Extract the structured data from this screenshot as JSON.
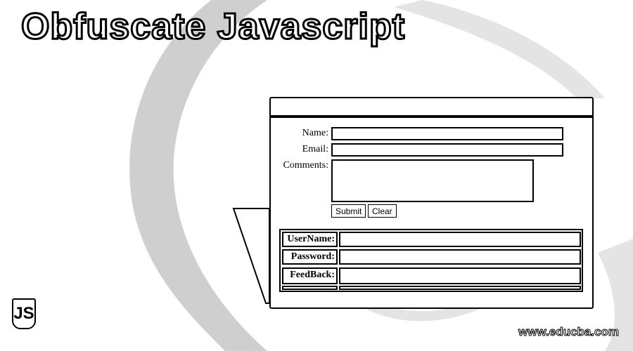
{
  "title": "Obfuscate Javascript",
  "form": {
    "name_label": "Name:",
    "email_label": "Email:",
    "comments_label": "Comments:",
    "name_value": "",
    "email_value": "",
    "comments_value": "",
    "submit_label": "Submit",
    "clear_label": "Clear"
  },
  "table": {
    "rows": [
      {
        "label": "UserName:",
        "value": ""
      },
      {
        "label": "Password:",
        "value": ""
      },
      {
        "label": "FeedBack:",
        "value": ""
      }
    ]
  },
  "logo": {
    "text": "JS"
  },
  "watermark": "www.educba.com",
  "colors": {
    "background": "#ffffff",
    "ink": "#000000",
    "swoosh": "#c8c8c8"
  }
}
